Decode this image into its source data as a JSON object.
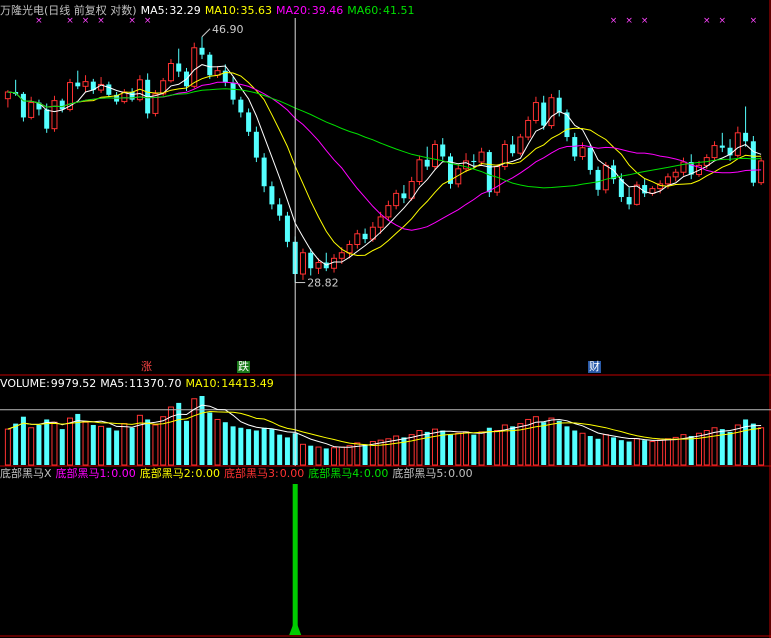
{
  "header": {
    "stock_title": "万隆光电(日线 前复权 对数)",
    "ma5_label": "MA5:",
    "ma5": "32.29",
    "ma10_label": "MA10:",
    "ma10": "35.63",
    "ma20_label": "MA20:",
    "ma20": "39.46",
    "ma60_label": "MA60:",
    "ma60": "41.51"
  },
  "volume_header": {
    "label": "VOLUME:",
    "value": "9979.52",
    "ma5_label": "MA5:",
    "ma5": "11370.70",
    "ma10_label": "MA10:",
    "ma10": "14413.49"
  },
  "indicator_header": {
    "title": "底部黑马X",
    "l1": "底部黑马1:",
    "v1": "0.00",
    "l2": "底部黑马2:",
    "v2": "0.00",
    "l3": "底部黑马3:",
    "v3": "0.00",
    "l4": "底部黑马4:",
    "v4": "0.00",
    "l5": "底部黑马5:",
    "v5": "0.00"
  },
  "markers": {
    "rise": "涨",
    "fall": "跌",
    "finance": "财"
  },
  "colors": {
    "up": "#ff3232",
    "down": "#54ffff",
    "ma5": "#ffffff",
    "ma10": "#ffff00",
    "ma20": "#ff00ff",
    "ma60": "#00e000",
    "vol_ma5": "#ffffff",
    "vol_ma10": "#ffff00",
    "signal": "#00cc00",
    "divider": "#c00000"
  },
  "chart_data": {
    "type": "candlestick",
    "price_scale": "log",
    "ylim": [
      24.5,
      53
    ],
    "high_label": "46.90",
    "low_label": "28.82",
    "candles": [
      [
        44.3,
        45.2,
        43.4,
        45.0
      ],
      [
        45.0,
        46.3,
        44.6,
        44.8
      ],
      [
        44.8,
        45.0,
        42.0,
        42.4
      ],
      [
        42.4,
        44.5,
        42.2,
        43.9
      ],
      [
        43.9,
        44.2,
        42.6,
        43.2
      ],
      [
        43.2,
        43.8,
        40.9,
        41.3
      ],
      [
        41.3,
        44.6,
        41.0,
        44.1
      ],
      [
        44.1,
        44.3,
        42.9,
        43.2
      ],
      [
        43.2,
        46.4,
        43.0,
        46.0
      ],
      [
        46.0,
        47.3,
        45.3,
        45.6
      ],
      [
        45.6,
        46.8,
        45.0,
        46.1
      ],
      [
        46.1,
        46.4,
        44.8,
        45.2
      ],
      [
        45.2,
        46.6,
        44.9,
        45.8
      ],
      [
        45.8,
        46.1,
        44.5,
        44.7
      ],
      [
        44.7,
        45.0,
        43.7,
        44.0
      ],
      [
        44.0,
        45.3,
        43.8,
        45.0
      ],
      [
        45.0,
        45.4,
        44.0,
        44.2
      ],
      [
        44.2,
        46.8,
        44.0,
        46.3
      ],
      [
        46.3,
        47.0,
        42.3,
        42.8
      ],
      [
        42.8,
        45.2,
        42.5,
        44.8
      ],
      [
        44.8,
        46.5,
        44.6,
        46.2
      ],
      [
        46.2,
        48.6,
        46.0,
        48.1
      ],
      [
        48.1,
        49.8,
        46.6,
        47.2
      ],
      [
        47.2,
        47.6,
        45.1,
        45.6
      ],
      [
        45.6,
        50.5,
        45.4,
        49.9
      ],
      [
        49.9,
        51.2,
        48.6,
        49.1
      ],
      [
        49.1,
        49.4,
        46.4,
        46.8
      ],
      [
        46.8,
        47.8,
        46.5,
        47.3
      ],
      [
        47.3,
        48.0,
        45.6,
        46.0
      ],
      [
        46.0,
        46.6,
        43.7,
        44.2
      ],
      [
        44.2,
        44.5,
        42.4,
        42.9
      ],
      [
        42.9,
        43.3,
        40.6,
        41.0
      ],
      [
        41.0,
        41.5,
        38.2,
        38.6
      ],
      [
        38.6,
        39.0,
        35.6,
        36.1
      ],
      [
        36.1,
        36.5,
        34.2,
        34.6
      ],
      [
        34.6,
        35.1,
        33.3,
        33.7
      ],
      [
        33.7,
        34.0,
        31.3,
        31.7
      ],
      [
        31.7,
        32.1,
        28.82,
        29.4
      ],
      [
        29.4,
        31.2,
        29.0,
        30.9
      ],
      [
        30.9,
        31.2,
        29.3,
        29.8
      ],
      [
        29.8,
        30.5,
        29.4,
        30.2
      ],
      [
        30.2,
        30.9,
        29.6,
        29.8
      ],
      [
        29.8,
        30.8,
        29.5,
        30.5
      ],
      [
        30.5,
        31.3,
        30.1,
        30.9
      ],
      [
        30.9,
        31.8,
        30.5,
        31.5
      ],
      [
        31.5,
        32.6,
        31.2,
        32.3
      ],
      [
        32.3,
        32.7,
        31.6,
        31.9
      ],
      [
        31.9,
        33.2,
        31.7,
        32.8
      ],
      [
        32.8,
        34.0,
        32.3,
        33.6
      ],
      [
        33.6,
        34.9,
        33.3,
        34.5
      ],
      [
        34.5,
        35.8,
        34.2,
        35.5
      ],
      [
        35.5,
        36.2,
        34.7,
        35.1
      ],
      [
        35.1,
        36.9,
        34.9,
        36.5
      ],
      [
        36.5,
        38.8,
        36.2,
        38.4
      ],
      [
        38.4,
        39.6,
        37.5,
        37.8
      ],
      [
        37.8,
        40.2,
        37.5,
        39.8
      ],
      [
        39.8,
        40.4,
        38.4,
        38.7
      ],
      [
        38.7,
        39.0,
        35.9,
        36.3
      ],
      [
        36.3,
        38.0,
        36.0,
        37.6
      ],
      [
        37.6,
        39.0,
        37.3,
        38.3
      ],
      [
        38.3,
        38.9,
        37.7,
        38.2
      ],
      [
        38.2,
        39.5,
        37.9,
        39.1
      ],
      [
        39.1,
        39.3,
        35.2,
        35.6
      ],
      [
        35.6,
        38.0,
        35.3,
        37.8
      ],
      [
        37.8,
        40.2,
        37.5,
        39.8
      ],
      [
        39.8,
        40.6,
        38.7,
        39.0
      ],
      [
        39.0,
        40.8,
        38.8,
        40.5
      ],
      [
        40.5,
        42.5,
        40.2,
        42.1
      ],
      [
        42.1,
        44.5,
        41.8,
        43.9
      ],
      [
        43.9,
        44.6,
        41.2,
        41.6
      ],
      [
        41.6,
        44.8,
        41.3,
        44.4
      ],
      [
        44.4,
        45.2,
        42.5,
        42.9
      ],
      [
        42.9,
        43.2,
        40.1,
        40.5
      ],
      [
        40.5,
        40.9,
        38.3,
        38.7
      ],
      [
        38.7,
        40.0,
        38.4,
        39.5
      ],
      [
        39.5,
        39.8,
        37.1,
        37.5
      ],
      [
        37.5,
        37.8,
        35.3,
        35.8
      ],
      [
        35.8,
        38.2,
        35.5,
        37.9
      ],
      [
        37.9,
        38.4,
        36.3,
        36.7
      ],
      [
        36.7,
        37.2,
        34.8,
        35.2
      ],
      [
        35.2,
        36.0,
        34.2,
        34.6
      ],
      [
        34.6,
        36.5,
        34.5,
        36.2
      ],
      [
        36.2,
        36.7,
        35.2,
        35.5
      ],
      [
        35.5,
        36.1,
        35.3,
        35.9
      ],
      [
        35.9,
        36.6,
        35.5,
        36.3
      ],
      [
        36.3,
        37.2,
        35.9,
        36.9
      ],
      [
        36.9,
        37.6,
        36.5,
        37.3
      ],
      [
        37.3,
        38.6,
        37.0,
        38.2
      ],
      [
        38.2,
        38.9,
        36.7,
        37.1
      ],
      [
        37.1,
        38.3,
        36.9,
        37.9
      ],
      [
        37.9,
        38.9,
        37.6,
        38.6
      ],
      [
        38.6,
        40.1,
        38.3,
        39.7
      ],
      [
        39.7,
        40.9,
        39.1,
        39.5
      ],
      [
        39.5,
        40.3,
        38.3,
        38.8
      ],
      [
        38.8,
        41.5,
        38.6,
        40.9
      ],
      [
        40.9,
        43.5,
        39.6,
        40.1
      ],
      [
        40.1,
        40.6,
        36.1,
        36.4
      ],
      [
        36.4,
        38.6,
        36.2,
        38.3
      ]
    ],
    "volume_scale": [
      0,
      50000
    ],
    "volume": [
      26000,
      30000,
      35000,
      27000,
      29000,
      33000,
      31000,
      26000,
      34000,
      37000,
      31000,
      29000,
      28000,
      27000,
      25000,
      30000,
      27000,
      36000,
      33000,
      29000,
      35000,
      42000,
      45000,
      32000,
      48000,
      50000,
      38000,
      33000,
      31000,
      28000,
      27000,
      26000,
      25000,
      27000,
      26000,
      22000,
      20000,
      23000,
      15000,
      14000,
      13000,
      12000,
      12500,
      13000,
      14000,
      16000,
      15000,
      17000,
      18000,
      19000,
      21000,
      20000,
      22000,
      25000,
      24000,
      26000,
      25000,
      22000,
      23000,
      24000,
      22000,
      24000,
      27000,
      25000,
      29000,
      28000,
      30000,
      33000,
      35000,
      31000,
      34000,
      32000,
      28000,
      25000,
      23000,
      21000,
      19000,
      22000,
      20000,
      18000,
      17000,
      19000,
      18000,
      17000,
      18000,
      19000,
      20000,
      22000,
      21000,
      23000,
      25000,
      27000,
      26000,
      24000,
      29000,
      33000,
      30000,
      27000
    ],
    "signal_index": 37
  }
}
